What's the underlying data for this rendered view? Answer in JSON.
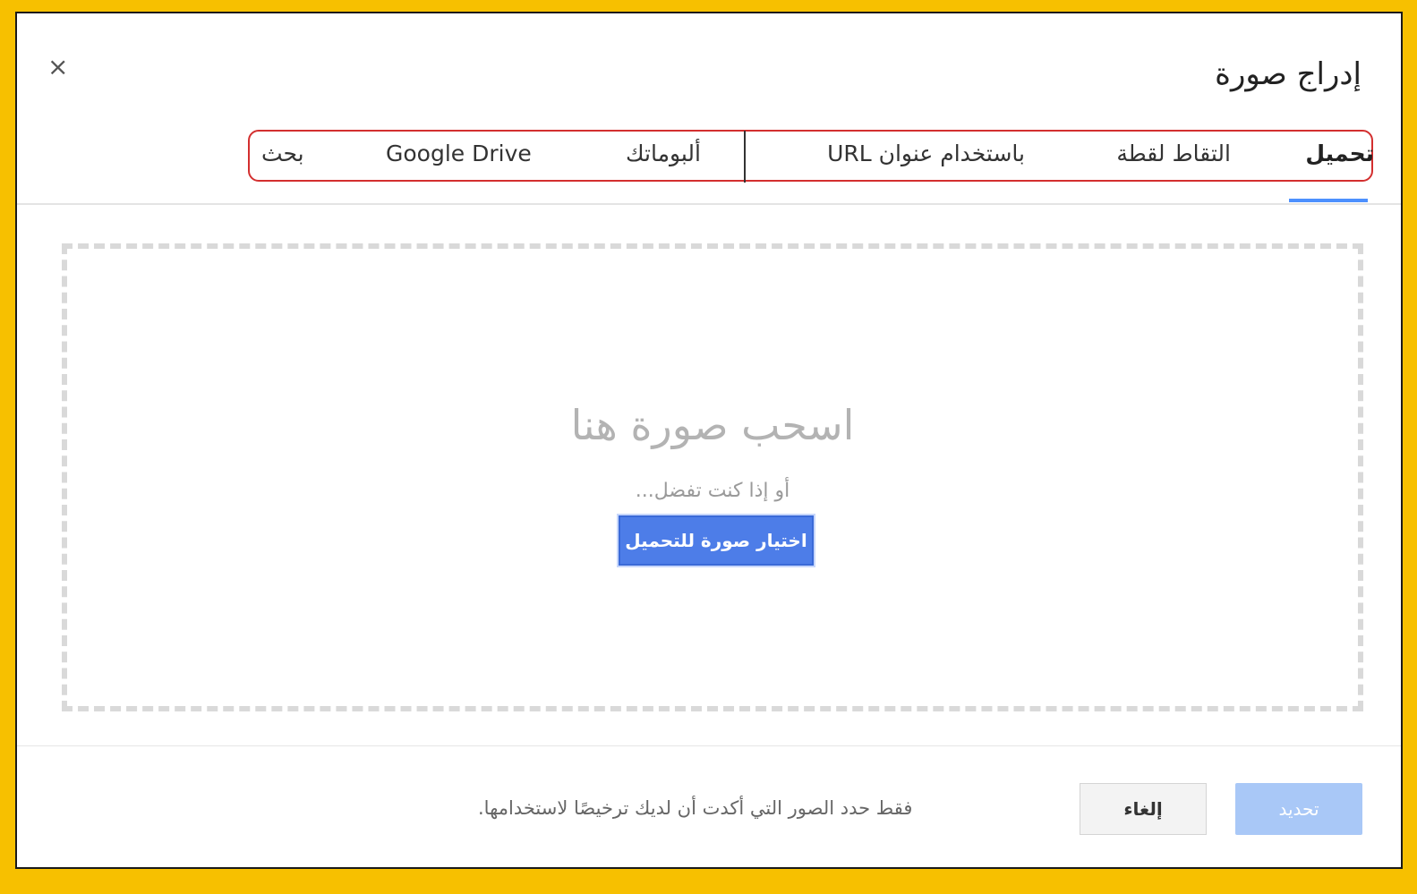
{
  "dialog": {
    "title": "إدراج صورة",
    "close_label": "×"
  },
  "tabs": [
    {
      "label": "تحميل",
      "active": true
    },
    {
      "label": "التقاط لقطة",
      "active": false
    },
    {
      "label": "باستخدام عنوان URL",
      "active": false
    },
    {
      "label": "ألبوماتك",
      "active": false
    },
    {
      "label": "Google Drive",
      "active": false
    },
    {
      "label": "بحث",
      "active": false
    }
  ],
  "dropzone": {
    "drag_text": "اسحب صورة هنا",
    "or_text": "أو إذا كنت تفضل...",
    "choose_button": "اختيار صورة للتحميل"
  },
  "footer": {
    "select_button": "تحديد",
    "cancel_button": "إلغاء",
    "note": "فقط حدد الصور التي أكدت أن لديك ترخيصًا لاستخدامها."
  },
  "colors": {
    "frame": "#f7c000",
    "accent": "#4d90fe",
    "tab_outline": "#d32f2f",
    "primary_button": "#4d7de8",
    "disabled_button": "#a9c8f7"
  }
}
